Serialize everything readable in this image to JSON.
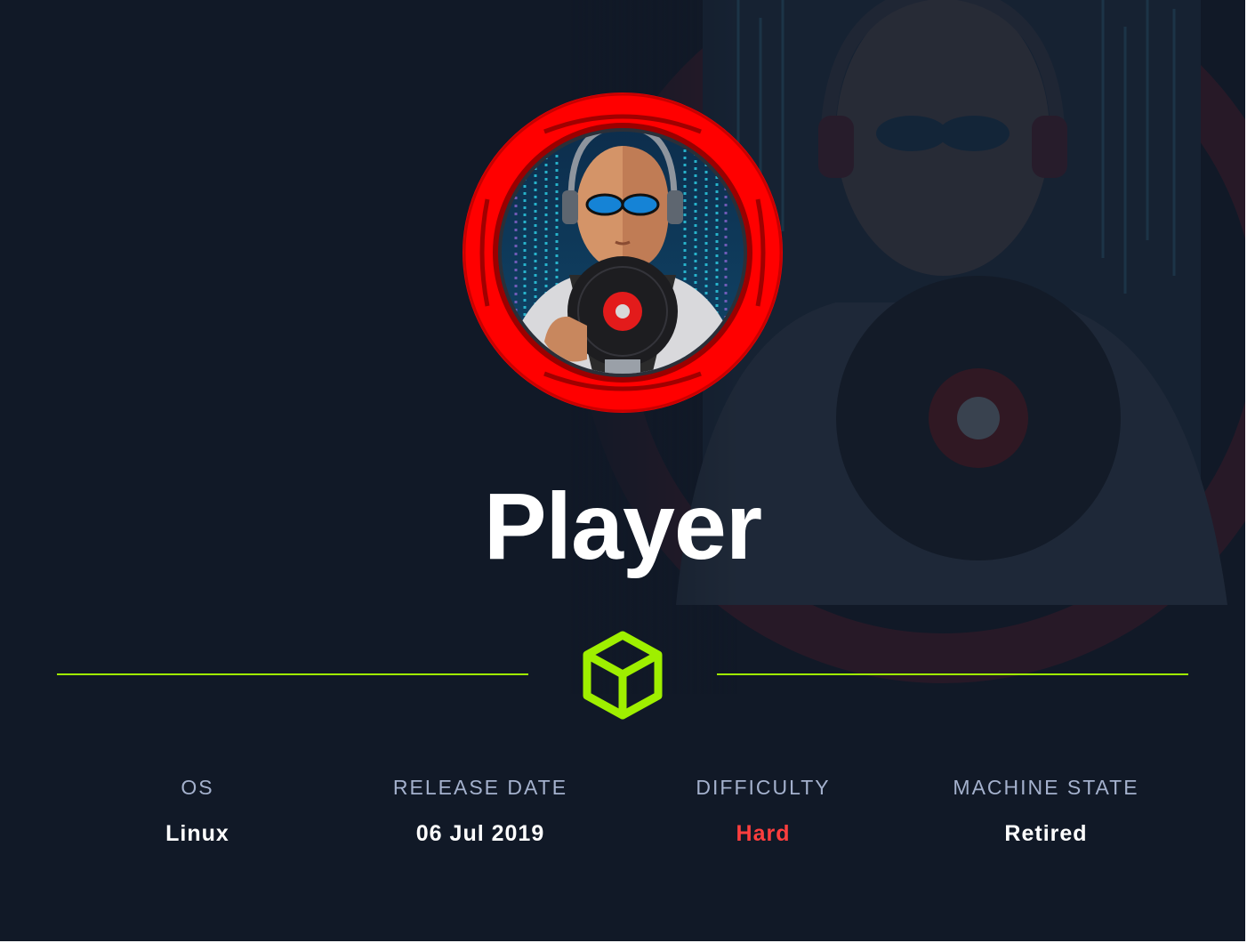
{
  "machine": {
    "name": "Player"
  },
  "info": [
    {
      "label": "OS",
      "value": "Linux"
    },
    {
      "label": "RELEASE DATE",
      "value": "06 Jul 2019"
    },
    {
      "label": "DIFFICULTY",
      "value": "Hard"
    },
    {
      "label": "MACHINE STATE",
      "value": "Retired"
    }
  ],
  "icons": {
    "avatar": "player-avatar",
    "divider": "cube-icon"
  },
  "colors": {
    "background": "#111927",
    "accent": "#9fef00",
    "difficulty_hard": "#ff3e3e",
    "avatar_ring": "#ff0000",
    "label": "#a4b1cd",
    "value": "#ffffff"
  }
}
